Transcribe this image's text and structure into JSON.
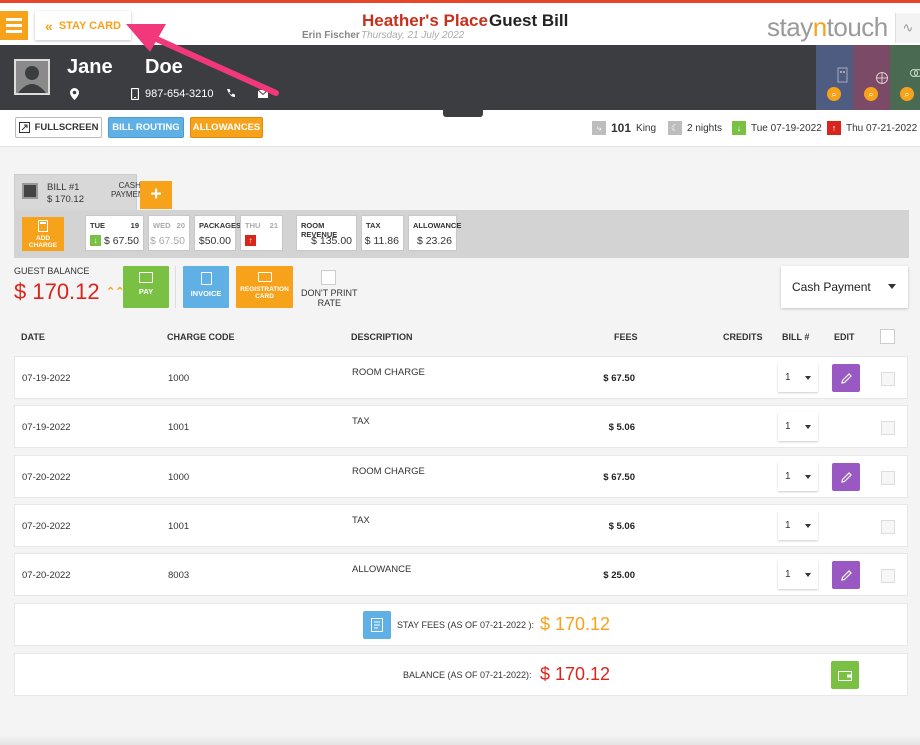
{
  "header": {
    "stay_card_label": "STAY CARD",
    "hotel_name": "Heather's Place",
    "page_title": "Guest Bill",
    "staff_name": "Erin Fischer",
    "business_date": "Thursday, 21 July 2022",
    "logo_left": "stay",
    "logo_mid": "n",
    "logo_right": "touch"
  },
  "guest": {
    "first_name": "Jane",
    "last_name": "Doe",
    "phone": "987-654-3210"
  },
  "toolbar": {
    "fullscreen_label": "FULLSCREEN",
    "bill_routing_label": "BILL ROUTING",
    "allowances_label": "ALLOWANCES"
  },
  "reservation": {
    "room_number": "101",
    "room_type": "King",
    "nights": "2 nights",
    "arrival": "Tue 07-19-2022",
    "departure": "Thu 07-21-2022"
  },
  "bill_tab": {
    "label": "BILL #1",
    "amount": "$ 170.12",
    "payment_line1": "CASH",
    "payment_line2": "PAYMENT",
    "add_symbol": "+"
  },
  "summary_strip": {
    "add_charge_line1": "ADD",
    "add_charge_line2": "CHARGE",
    "days": [
      {
        "day": "TUE",
        "date": "19",
        "amount": "$ 67.50"
      },
      {
        "day": "WED",
        "date": "20",
        "amount": "$ 67.50"
      },
      {
        "day": "THU",
        "date": "21",
        "amount": ""
      }
    ],
    "packages_label": "PACKAGES",
    "packages_amount": "$50.00",
    "room_revenue_label": "ROOM REVENUE",
    "room_revenue_amount": "$ 135.00",
    "tax_label": "TAX",
    "tax_amount": "$ 11.86",
    "allowance_label": "ALLOWANCE",
    "allowance_amount": "$ 23.26"
  },
  "balance": {
    "label": "GUEST BALANCE",
    "amount": "$ 170.12"
  },
  "actions": {
    "pay_label": "PAY",
    "invoice_label": "INVOICE",
    "registration_line1": "REGISTRATION",
    "registration_line2": "CARD",
    "dont_print_line1": "DON'T PRINT",
    "dont_print_line2": "RATE",
    "payment_method": "Cash Payment"
  },
  "table": {
    "headers": {
      "date": "DATE",
      "charge_code": "CHARGE CODE",
      "description": "DESCRIPTION",
      "fees": "FEES",
      "credits": "CREDITS",
      "bill_no": "BILL #",
      "edit": "EDIT"
    },
    "rows": [
      {
        "date": "07-19-2022",
        "code": "1000",
        "description": "ROOM CHARGE",
        "fees": "$ 67.50",
        "bill": "1"
      },
      {
        "date": "07-19-2022",
        "code": "1001",
        "description": "TAX",
        "fees": "$ 5.06",
        "bill": "1"
      },
      {
        "date": "07-20-2022",
        "code": "1000",
        "description": "ROOM CHARGE",
        "fees": "$ 67.50",
        "bill": "1"
      },
      {
        "date": "07-20-2022",
        "code": "1001",
        "description": "TAX",
        "fees": "$ 5.06",
        "bill": "1"
      },
      {
        "date": "07-20-2022",
        "code": "8003",
        "description": "ALLOWANCE",
        "fees": "$ 25.00",
        "bill": "1"
      }
    ]
  },
  "totals": {
    "stay_fees_label": "STAY FEES (AS OF  07-21-2022 ):",
    "stay_fees_amount": "$ 170.12",
    "balance_label": "BALANCE (AS OF  07-21-2022):",
    "balance_amount": "$ 170.12"
  },
  "colors": {
    "accent_orange": "#f7a21b",
    "hotel_red": "#c8301e",
    "balance_red": "#d9261c",
    "blue": "#5fb0e4",
    "green": "#7ac143",
    "purple": "#9a58c2",
    "annotation_pink": "#f0387a"
  }
}
